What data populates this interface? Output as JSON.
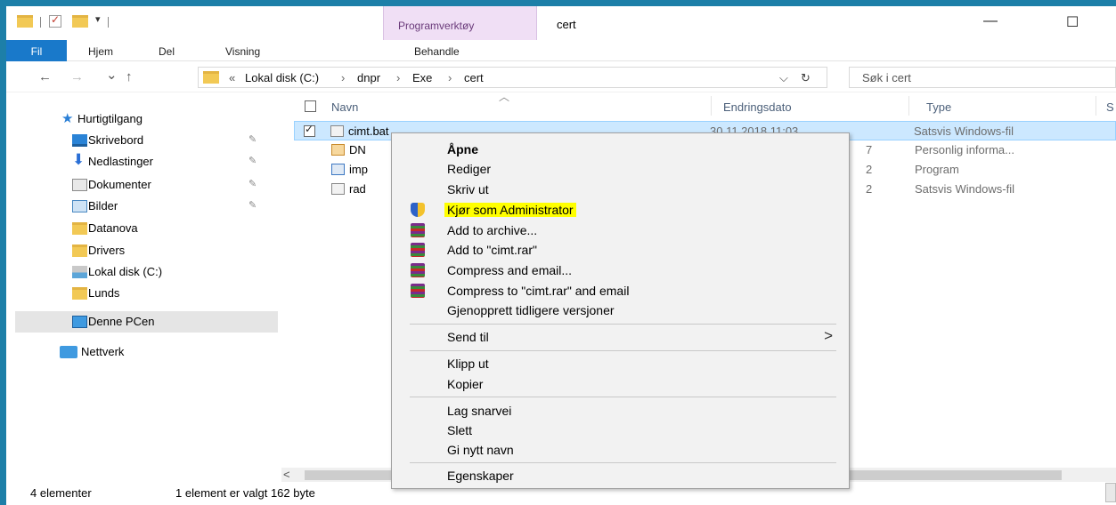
{
  "window": {
    "title": "cert",
    "context_tab_title": "Programverktøy",
    "minimize_glyph": "—",
    "maximize_glyph": "☐"
  },
  "ribbon": {
    "tabs": [
      "Fil",
      "Hjem",
      "Del",
      "Visning",
      "Behandle"
    ]
  },
  "address": {
    "overflow": "«",
    "crumbs": [
      "Lokal disk (C:)",
      "dnpr",
      "Exe",
      "cert"
    ],
    "separator": "›",
    "dropdown_glyph": "⌵",
    "refresh_glyph": "↻",
    "search_placeholder": "Søk i cert"
  },
  "nav": {
    "back": "←",
    "forward": "→",
    "recent": "⌄",
    "up": "↑",
    "items": [
      {
        "label": "Hurtigtilgang",
        "icon": "star-icon",
        "pinned": false
      },
      {
        "label": "Skrivebord",
        "icon": "desktop-icon",
        "pinned": true
      },
      {
        "label": "Nedlastinger",
        "icon": "download-icon",
        "pinned": true
      },
      {
        "label": "Dokumenter",
        "icon": "documents-icon",
        "pinned": true
      },
      {
        "label": "Bilder",
        "icon": "pictures-icon",
        "pinned": true
      },
      {
        "label": "Datanova",
        "icon": "folder-icon",
        "pinned": false
      },
      {
        "label": "Drivers",
        "icon": "folder-icon",
        "pinned": false
      },
      {
        "label": "Lokal disk (C:)",
        "icon": "drive-icon",
        "pinned": false
      },
      {
        "label": "Lunds",
        "icon": "folder-icon",
        "pinned": false
      },
      {
        "label": "Denne PCen",
        "icon": "computer-icon",
        "pinned": false
      },
      {
        "label": "Nettverk",
        "icon": "network-icon",
        "pinned": false
      }
    ],
    "pin_glyph": "📌"
  },
  "columns": {
    "name": "Navn",
    "date": "Endringsdato",
    "type": "Type",
    "size": "S"
  },
  "files": [
    {
      "name": "cimt.bat",
      "date": "30.11.2018 11:03",
      "type": "Satsvis Windows-fil",
      "selected": true
    },
    {
      "name": "DN",
      "date": "7",
      "type": "Personlig informa...",
      "selected": false
    },
    {
      "name": "imp",
      "date": "2",
      "type": "Program",
      "selected": false
    },
    {
      "name": "rad",
      "date": "2",
      "type": "Satsvis Windows-fil",
      "selected": false
    }
  ],
  "context_menu": {
    "items": [
      {
        "label": "Åpne",
        "bold": true
      },
      {
        "label": "Rediger"
      },
      {
        "label": "Skriv ut"
      },
      {
        "label": "Kjør som Administrator",
        "icon": "shield-icon",
        "highlight": true
      },
      {
        "label": "Add to archive...",
        "icon": "winrar-icon"
      },
      {
        "label": "Add to \"cimt.rar\"",
        "icon": "winrar-icon"
      },
      {
        "label": "Compress and email...",
        "icon": "winrar-icon"
      },
      {
        "label": "Compress to \"cimt.rar\" and email",
        "icon": "winrar-icon"
      },
      {
        "label": "Gjenopprett tidligere versjoner"
      },
      {
        "label": "Send til",
        "submenu": true
      },
      {
        "label": "Klipp ut"
      },
      {
        "label": "Kopier"
      },
      {
        "label": "Lag snarvei"
      },
      {
        "label": "Slett"
      },
      {
        "label": "Gi nytt navn"
      },
      {
        "label": "Egenskaper"
      }
    ],
    "submenu_arrow": ">"
  },
  "status": {
    "count": "4 elementer",
    "selection": "1 element er valgt  162 byte"
  },
  "scroll": {
    "left_arrow": "<"
  },
  "colors": {
    "accent": "#1979ca",
    "frame": "#1d7fa8",
    "selection": "#cce8ff",
    "highlight": "#ffff00",
    "context_tab": "#f0dff5"
  }
}
